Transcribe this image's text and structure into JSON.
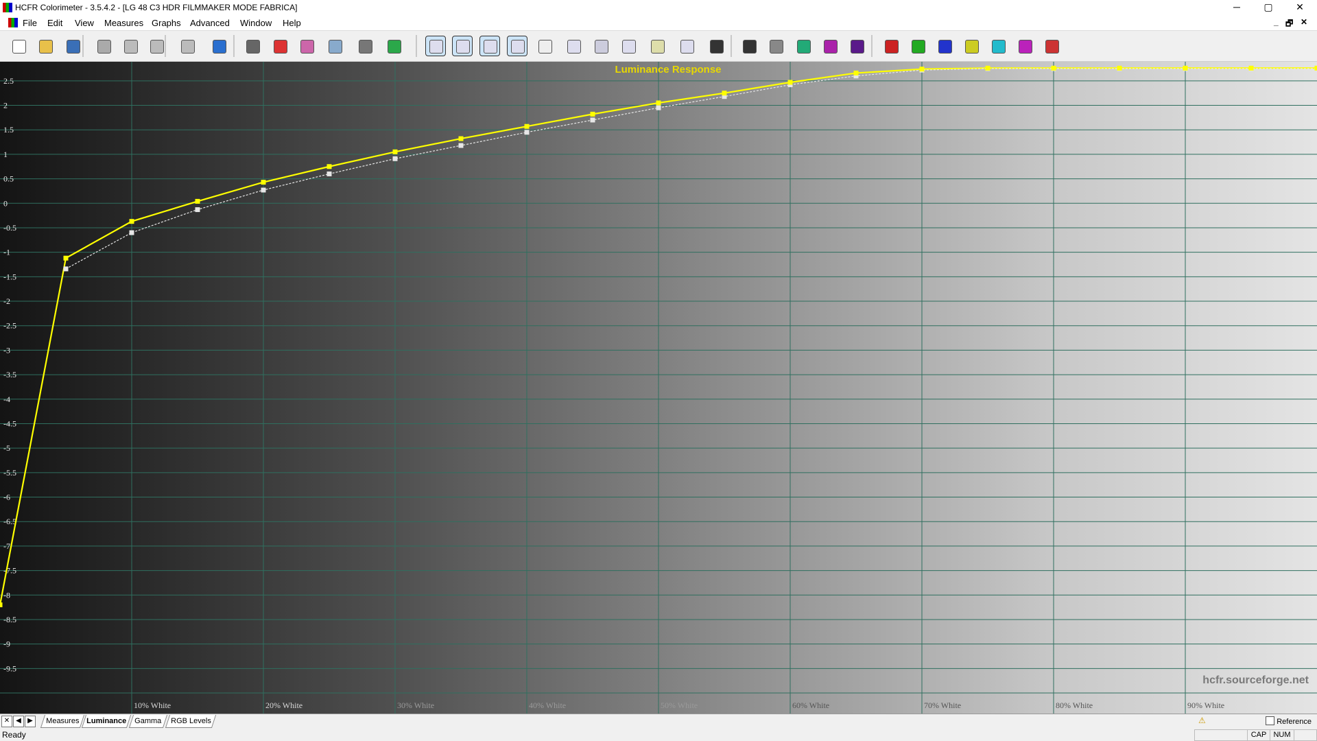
{
  "window": {
    "title": "HCFR Colorimeter - 3.5.4.2 - [LG 48 C3 HDR FILMMAKER MODE FABRICA]",
    "controls": {
      "minimize": "─",
      "maximize": "▢",
      "close": "✕"
    },
    "mdi_controls": {
      "minimize": "_",
      "restore": "🗗",
      "close": "✕"
    }
  },
  "menubar": {
    "items": [
      "File",
      "Edit",
      "View",
      "Measures",
      "Graphs",
      "Advanced",
      "Window",
      "Help"
    ]
  },
  "toolbar": {
    "icons": [
      "new-document-icon",
      "open-folder-icon",
      "save-icon",
      "cut-icon",
      "copy-icon",
      "paste-icon",
      "print-icon",
      "help-icon",
      "sensor-icon",
      "rgb-spheres-icon",
      "colors-icon",
      "palette-icon",
      "camera-icon",
      "play-icon",
      "monitor-view-icon",
      "luminance-view-icon",
      "gamma-view-icon",
      "rgb-levels-view-icon",
      "chroma-view-icon",
      "cie-view-icon",
      "saturation-view-icon",
      "saturation-lum-view-icon",
      "color-temp-view-icon",
      "delta-e-view-icon",
      "display-view-icon",
      "grayscale-film-icon",
      "grayscale-film-outline-icon",
      "primaries-film-icon",
      "secondaries-film-icon",
      "galaxy-icon",
      "red-film-icon",
      "green-film-icon",
      "blue-film-icon",
      "yellow-film-icon",
      "cyan-film-icon",
      "magenta-film-icon",
      "mixed-film-icon"
    ]
  },
  "chart_data": {
    "type": "line",
    "title": "Luminance Response",
    "watermark": "hcfr.sourceforge.net",
    "ylim": [
      -10,
      2.75
    ],
    "yticks": [
      "2.5",
      "2",
      "1.5",
      "1",
      "0.5",
      "0",
      "-0.5",
      "-1",
      "-1.5",
      "-2",
      "-2.5",
      "-3",
      "-3.5",
      "-4",
      "-4.5",
      "-5",
      "-5.5",
      "-6",
      "-6.5",
      "-7",
      "-7.5",
      "-8",
      "-8.5",
      "-9",
      "-9.5"
    ],
    "xlim": [
      0,
      100
    ],
    "xticks": [
      "10% White",
      "20% White",
      "30% White",
      "40% White",
      "50% White",
      "60% White",
      "70% White",
      "80% White",
      "90% White"
    ],
    "x": [
      0,
      5,
      10,
      15,
      20,
      25,
      30,
      35,
      40,
      45,
      50,
      55,
      60,
      65,
      70,
      75,
      80,
      85,
      90,
      95,
      100
    ],
    "series": [
      {
        "color": "#ffff00",
        "style": "solid",
        "values": [
          -8.2,
          -1.12,
          -0.37,
          0.04,
          0.43,
          0.75,
          1.05,
          1.32,
          1.57,
          1.82,
          2.05,
          2.25,
          2.47,
          2.66,
          2.74,
          2.76,
          2.76,
          2.76,
          2.76,
          2.76,
          2.76
        ]
      },
      {
        "color": "#e6e6e6",
        "style": "dashed",
        "values": [
          null,
          -1.34,
          -0.6,
          -0.13,
          0.27,
          0.6,
          0.91,
          1.18,
          1.45,
          1.7,
          1.95,
          2.18,
          2.42,
          2.6,
          2.72,
          2.75,
          2.75,
          2.75,
          2.75,
          2.75,
          2.75
        ]
      }
    ],
    "grid": true
  },
  "tabs": {
    "items": [
      "Measures",
      "Luminance",
      "Gamma",
      "RGB Levels"
    ],
    "active": "Luminance",
    "nav": [
      "✕",
      "◀",
      "▶"
    ],
    "reference_label": "Reference"
  },
  "statusbar": {
    "text": "Ready",
    "cap": "CAP",
    "num": "NUM"
  }
}
